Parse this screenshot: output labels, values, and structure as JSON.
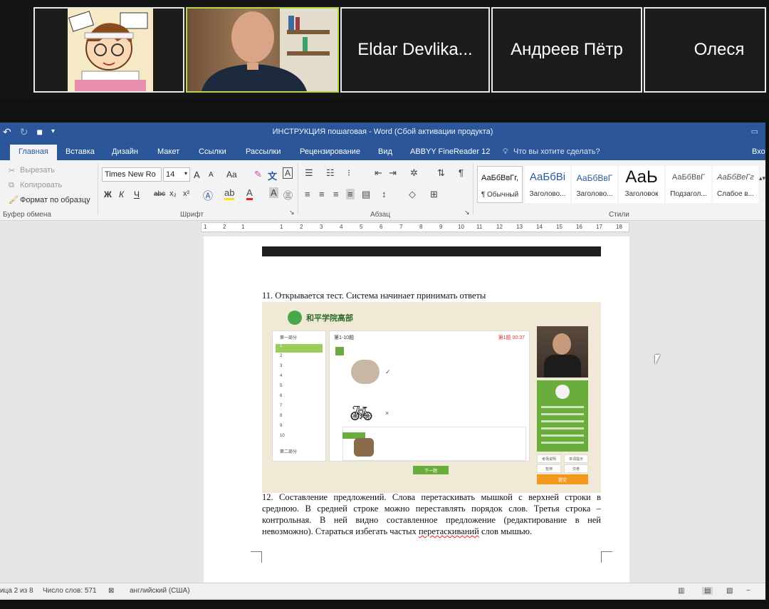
{
  "participants": [
    {
      "type": "cartoon-avatar",
      "name": ""
    },
    {
      "type": "video",
      "name": "",
      "active": true
    },
    {
      "type": "name",
      "name": "Eldar Devlika..."
    },
    {
      "type": "name",
      "name": "Андреев Пётр"
    },
    {
      "type": "name",
      "name": "Олеся"
    }
  ],
  "word": {
    "title": "ИНСТРУКЦИЯ пошаговая - Word (Сбой активации продукта)",
    "tabs": [
      "Главная",
      "Вставка",
      "Дизайн",
      "Макет",
      "Ссылки",
      "Рассылки",
      "Рецензирование",
      "Вид",
      "ABBYY FineReader 12"
    ],
    "tell_me": "Что вы хотите сделать?",
    "signin": "Вхо",
    "clipboard": {
      "cut": "Вырезать",
      "copy": "Копировать",
      "format": "Формат по образцу",
      "group": "Буфер обмена"
    },
    "font": {
      "name": "Times New Ro",
      "size": "14",
      "group": "Шрифт",
      "bold": "Ж",
      "italic": "К",
      "underline": "Ч",
      "strike": "abc",
      "sub": "x₂",
      "sup": "x²",
      "aa": "Aa",
      "grow": "A",
      "shrink": "A"
    },
    "paragraph": {
      "group": "Абзац"
    },
    "styles": {
      "group": "Стили",
      "items": [
        {
          "sample": "АаБбВвГг,",
          "name": "¶ Обычный"
        },
        {
          "sample": "АаБбВі",
          "name": "Заголово..."
        },
        {
          "sample": "АаБбВвГ",
          "name": "Заголово..."
        },
        {
          "sample": "АаЬ",
          "name": "Заголовок"
        },
        {
          "sample": "АаБбВвГ",
          "name": "Подзагол..."
        },
        {
          "sample": "АаБбВеГг",
          "name": "Слабое в..."
        }
      ]
    },
    "ruler_ticks": [
      "1",
      "2",
      "1",
      "1",
      "2",
      "3",
      "4",
      "5",
      "6",
      "7",
      "8",
      "9",
      "10",
      "11",
      "12",
      "13",
      "14",
      "15",
      "16",
      "17",
      "18"
    ],
    "doc": {
      "item11": "11.     Открывается тест. Система начинает принимать ответы",
      "item12_a": "12.     Составление предложений. Слова перетаскивать мышкой с верхней строки в среднюю. В средней строке можно переставлять порядок слов. Третья строка – контрольная. В ней видно составленное предложение (редактирование в ней невозможно). Стараться избегать частых ",
      "item12_err": "перетаскиваний",
      "item12_b": " слов мышью."
    },
    "screenshot": {
      "logo": "和平学院高部",
      "question_header": "第1-10题",
      "timer": "第1题 00:37",
      "list": [
        "第一部分",
        "1",
        "2",
        "3",
        "4",
        "5",
        "6",
        "7",
        "8",
        "9",
        "10",
        "第二部分"
      ],
      "next": "下一题",
      "orange": "提交",
      "card_buttons": [
        "考场说明",
        "单词提示",
        "暂停",
        "交卷"
      ]
    },
    "status": {
      "page": "ица 2 из 8",
      "words": "Число слов: 571",
      "lang": "английский (США)"
    }
  }
}
